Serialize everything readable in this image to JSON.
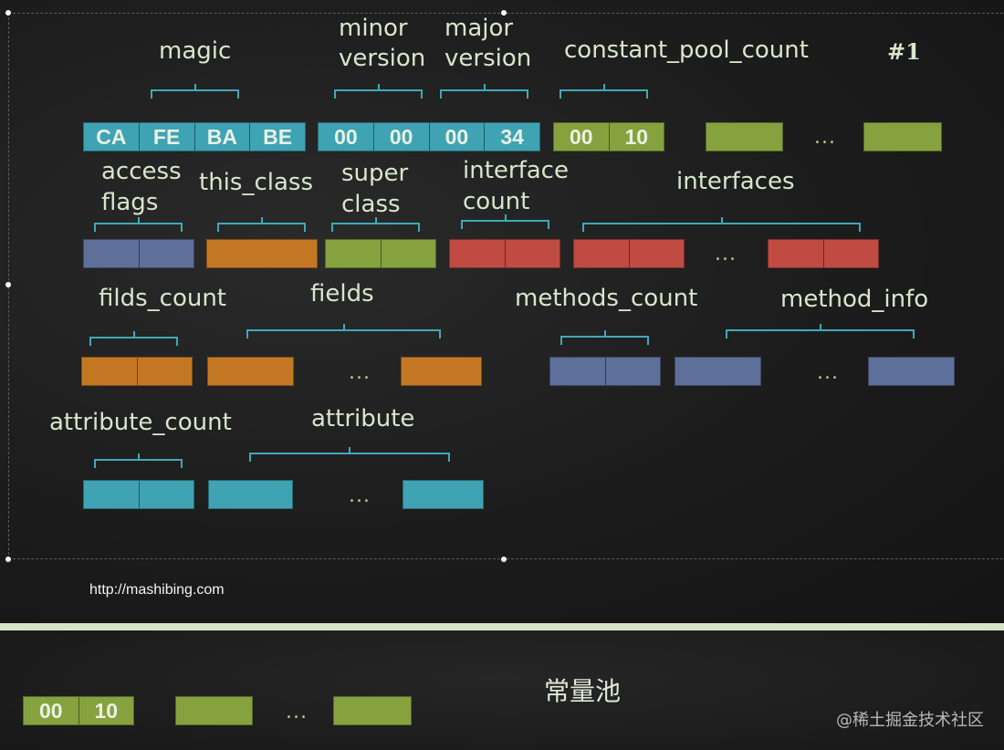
{
  "labels": {
    "magic": "magic",
    "minor_version": [
      "minor",
      "version"
    ],
    "major_version": [
      "major",
      "version"
    ],
    "constant_pool_count": "constant_pool_count",
    "slide_number": "#1",
    "access_flags": [
      "access",
      "flags"
    ],
    "this_class": "this_class",
    "super_class": [
      "super",
      "class"
    ],
    "interface_count": [
      "interface",
      "count"
    ],
    "interfaces": "interfaces",
    "filds_count": "filds_count",
    "fields": "fields",
    "methods_count": "methods_count",
    "method_info": "method_info",
    "attribute_count": "attribute_count",
    "attribute": "attribute"
  },
  "bytes": {
    "magic": [
      "CA",
      "FE",
      "BA",
      "BE"
    ],
    "minor_version": [
      "00",
      "00"
    ],
    "major_version": [
      "00",
      "34"
    ],
    "constant_pool_count": [
      "00",
      "10"
    ]
  },
  "ellipsis": "...",
  "url": "http://mashibing.com",
  "constant_pool_section": {
    "title": "常量池",
    "count_bytes": [
      "00",
      "10"
    ]
  },
  "watermark": "@稀土掘金技术社区",
  "colors": {
    "teal": "#3fa3b3",
    "green": "#86a23f",
    "slate": "#5e6f9a",
    "orange": "#c57823",
    "red": "#c04b43",
    "brace": "#3fa9b8",
    "label": "#d8e6cc",
    "divider": "#d6e4c4"
  }
}
